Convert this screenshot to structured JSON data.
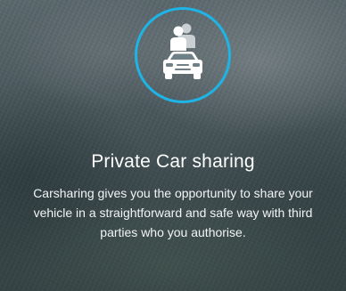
{
  "feature": {
    "icon": "car-sharing-icon",
    "title": "Private Car sharing",
    "description": "Carsharing gives you the opportunity to share your vehicle in a straightforward and safe way with third parties who you authorise."
  },
  "colors": {
    "ring_accent": "#1eb4e6",
    "text": "#ffffff"
  }
}
